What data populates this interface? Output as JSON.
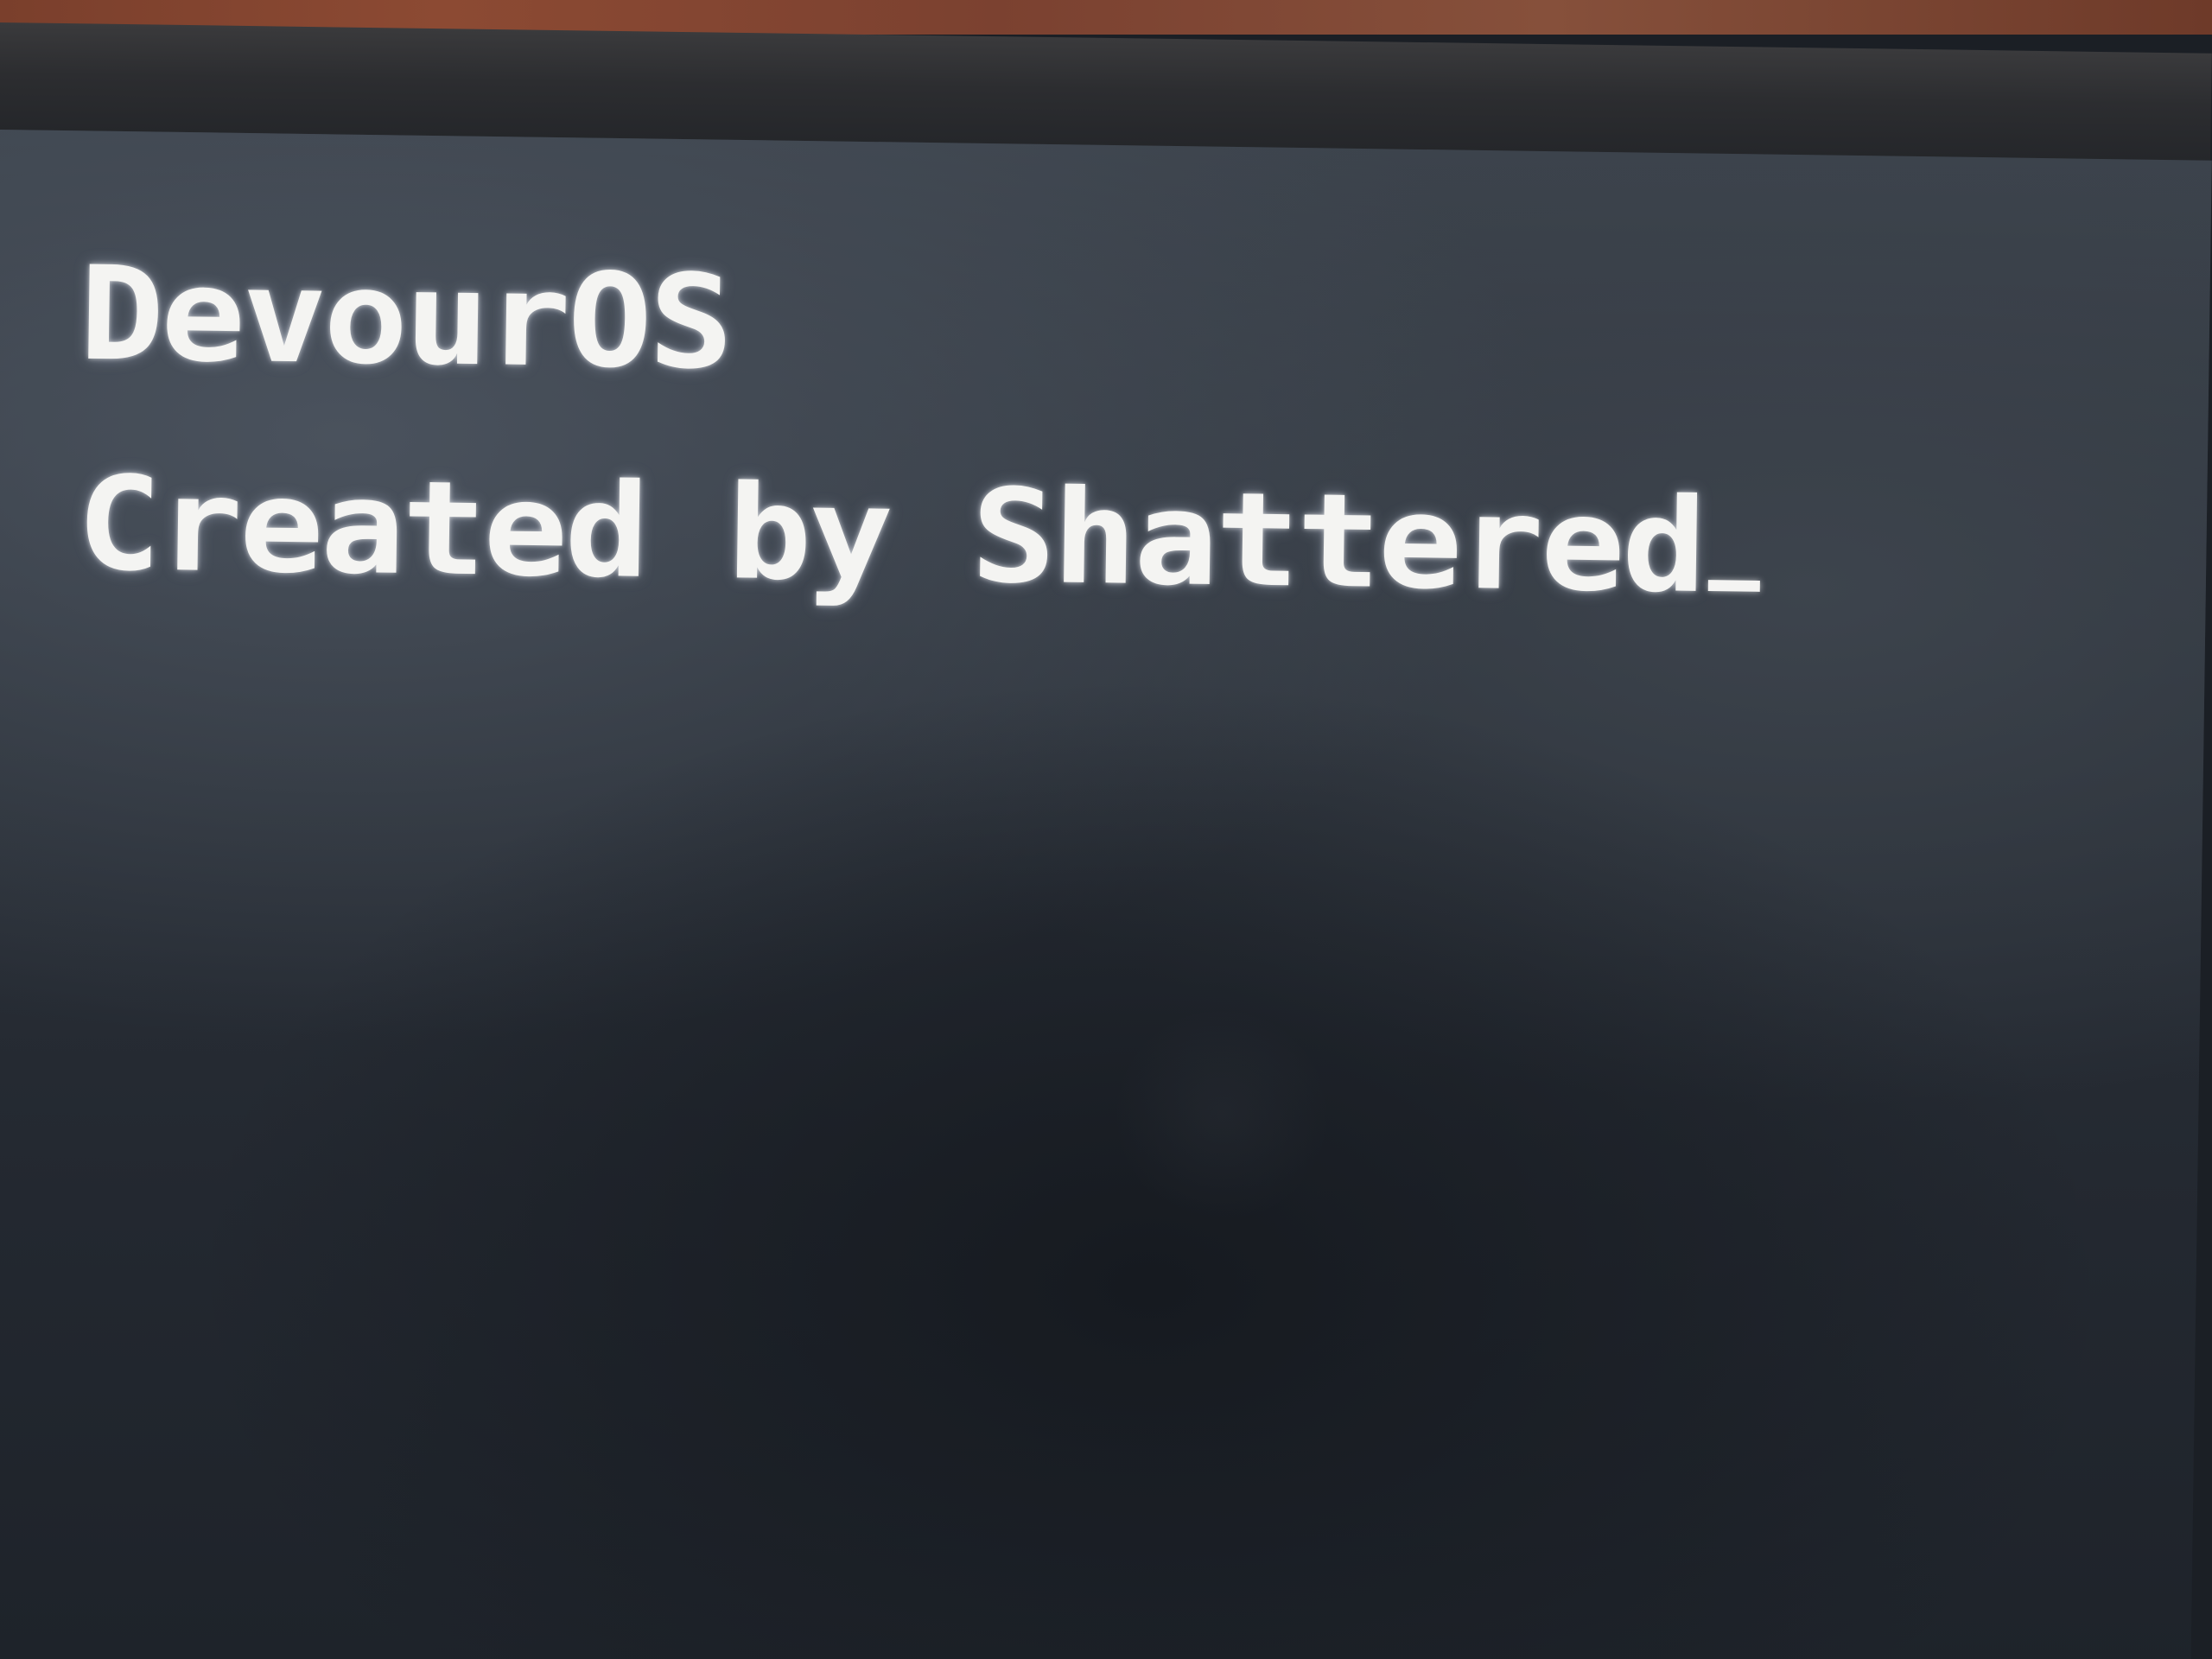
{
  "screen": {
    "lines": [
      "DevourOS",
      "Created by Shattered"
    ],
    "cursor_visible": true
  },
  "colors": {
    "text": "#f4f4f2",
    "background": "#2b3139",
    "bezel": "#2c2d30",
    "desk": "#8c4a33"
  }
}
